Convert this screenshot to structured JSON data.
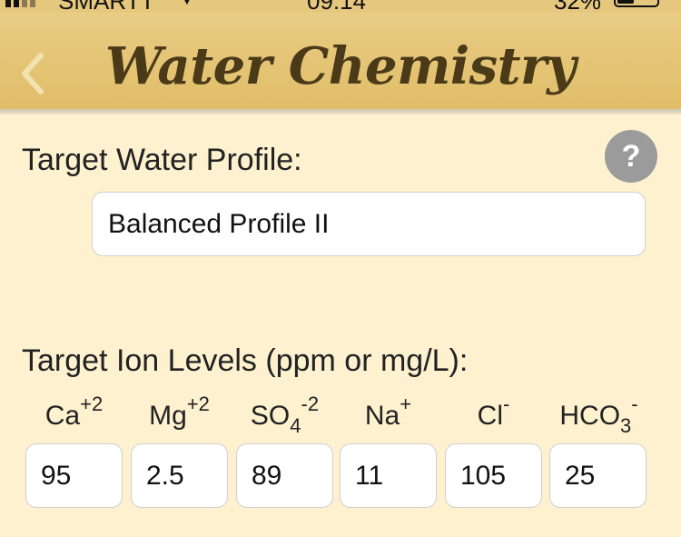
{
  "status_bar": {
    "carrier": "SMARTT",
    "time": "09:14",
    "battery_percent": "32%"
  },
  "nav": {
    "title": "Water Chemistry",
    "back_icon": "chevron-left-icon"
  },
  "profile": {
    "label": "Target Water Profile:",
    "value": "Balanced Profile II",
    "help_label": "?"
  },
  "ions": {
    "label": "Target Ion Levels (ppm or mg/L):",
    "items": [
      {
        "base": "Ca",
        "sub": "",
        "sup": "+2",
        "value": "95"
      },
      {
        "base": "Mg",
        "sub": "",
        "sup": "+2",
        "value": "2.5"
      },
      {
        "base": "SO",
        "sub": "4",
        "sup": "-2",
        "value": "89"
      },
      {
        "base": "Na",
        "sub": "",
        "sup": "+",
        "value": "11"
      },
      {
        "base": "Cl",
        "sub": "",
        "sup": "-",
        "value": "105"
      },
      {
        "base": "HCO",
        "sub": "3",
        "sup": "-",
        "value": "25"
      }
    ]
  },
  "colors": {
    "nav_background": "#e3c272",
    "page_background": "#fdf1cf",
    "title_color": "#4a3a18",
    "help_background": "#9b9b9b"
  }
}
